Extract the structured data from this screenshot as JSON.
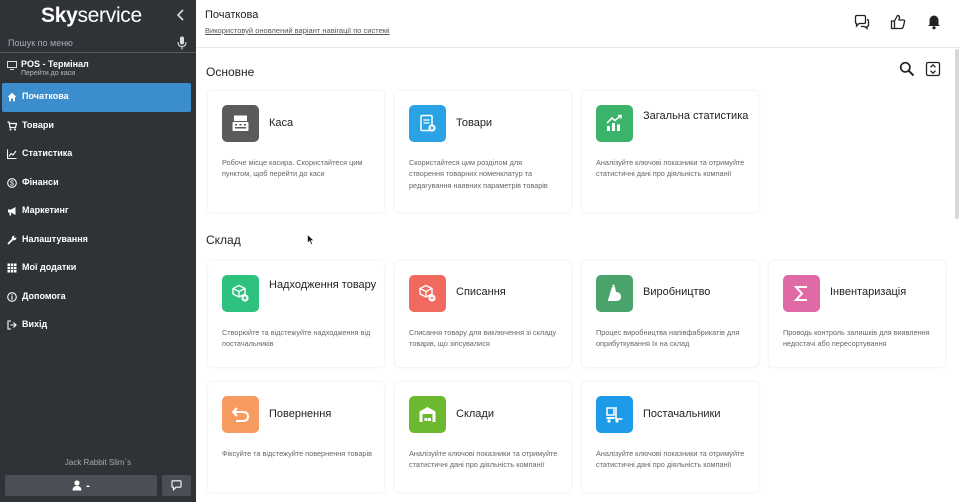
{
  "sidebar": {
    "logo_bold": "Sky",
    "logo_light": "service",
    "search_placeholder": "Пошук по меню",
    "pos": {
      "title": "POS - Термінал",
      "subtitle": "Перейти до каси"
    },
    "items": [
      {
        "label": "Початкова",
        "icon": "home-icon",
        "active": true
      },
      {
        "label": "Товари",
        "icon": "cart-icon"
      },
      {
        "label": "Статистика",
        "icon": "chart-icon"
      },
      {
        "label": "Фінанси",
        "icon": "coin-icon"
      },
      {
        "label": "Маркетинг",
        "icon": "megaphone-icon"
      },
      {
        "label": "Налаштування",
        "icon": "wrench-icon"
      },
      {
        "label": "Мої додатки",
        "icon": "grid-icon"
      },
      {
        "label": "Допомога",
        "icon": "info-icon"
      },
      {
        "label": "Вихід",
        "icon": "logout-icon"
      }
    ],
    "user_name": "Jack Rabbit Slim`s"
  },
  "header": {
    "title": "Початкова",
    "link": "Використовуй оновлений варіант навігації по системі"
  },
  "sections": {
    "main": {
      "title": "Основне",
      "cards": [
        {
          "title": "Каса",
          "desc": "Робоче місце касира. Скористайтеся цим пунктом, щоб перейти до каси",
          "color": "#5b5b5b",
          "icon": "cash-register-icon"
        },
        {
          "title": "Товари",
          "desc": "Скористайтеся цим розділом для створення товарних номенклатур та редагування наявних параметрів товарів",
          "color": "#29a3e6",
          "icon": "product-list-icon"
        },
        {
          "title": "Загальна статистика",
          "desc": "Аналізуйте ключові показники та отримуйте статистичні дані про діяльність компанії",
          "color": "#3bb36b",
          "icon": "statistics-icon"
        }
      ]
    },
    "warehouse": {
      "title": "Склад",
      "cards": [
        {
          "title": "Надходження товару",
          "desc": "Створюйте та відстежуйте надходження від постачальників",
          "color": "#2ec27e",
          "icon": "box-add-icon"
        },
        {
          "title": "Списання",
          "desc": "Списання товару для виключення зі складу товарів, що зіпсувалися",
          "color": "#f06a5f",
          "icon": "box-remove-icon"
        },
        {
          "title": "Виробництво",
          "desc": "Процес виробництва напівфабрикатів для оприбуткування їх на склад",
          "color": "#4aa36b",
          "icon": "production-icon"
        },
        {
          "title": "Інвентаризація",
          "desc": "Проводь контроль залишків для виявлення недостачі або пересортування",
          "color": "#e06aa6",
          "icon": "sigma-icon"
        },
        {
          "title": "Повернення",
          "desc": "Фіксуйте та відстежуйте повернення товарів",
          "color": "#f79b61",
          "icon": "return-icon"
        },
        {
          "title": "Склади",
          "desc": "Аналізуйте ключові показники та отримуйте статистичні дані про діяльність компанії",
          "color": "#6cb82f",
          "icon": "warehouse-icon"
        },
        {
          "title": "Постачальники",
          "desc": "Аналізуйте ключові показники та отримуйте статистичні дані про діяльність компанії",
          "color": "#1e9be8",
          "icon": "supplier-icon"
        }
      ]
    }
  }
}
